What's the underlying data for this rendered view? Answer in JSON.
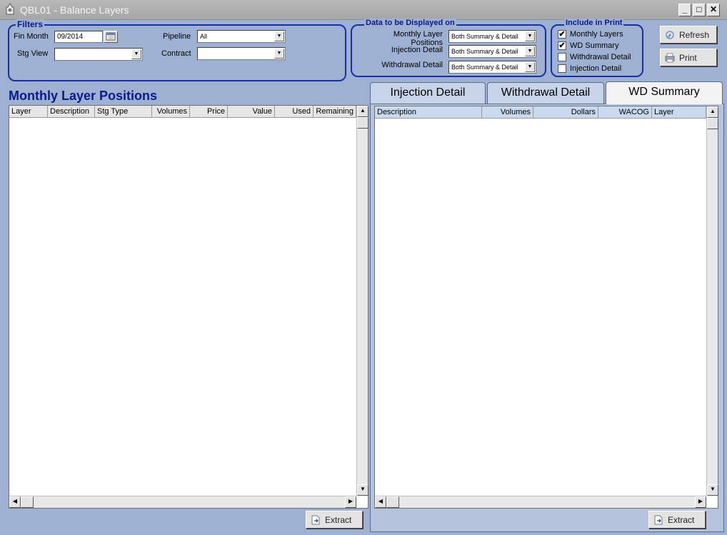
{
  "window": {
    "title": "QBL01 - Balance Layers",
    "minimize": "_",
    "maximize": "□",
    "close": "✕"
  },
  "filters": {
    "group_title": "Filters",
    "fin_month_label": "Fin Month",
    "fin_month_value": "09/2014",
    "stg_view_label": "Stg View",
    "stg_view_value": "",
    "pipeline_label": "Pipeline",
    "pipeline_value": "All",
    "contract_label": "Contract",
    "contract_value": ""
  },
  "display": {
    "group_title": "Data to be Displayed on",
    "rows": [
      {
        "label": "Monthly Layer Positions",
        "value": "Both Summary & Detail"
      },
      {
        "label": "Injection Detail",
        "value": "Both Summary & Detail"
      },
      {
        "label": "Withdrawal Detail",
        "value": "Both Summary & Detail"
      }
    ]
  },
  "print_opts": {
    "group_title": "Include in Print",
    "items": [
      {
        "label": "Monthly Layers",
        "checked": "✔"
      },
      {
        "label": "WD Summary",
        "checked": "✔"
      },
      {
        "label": "Withdrawal Detail",
        "checked": ""
      },
      {
        "label": "Injection Detail",
        "checked": ""
      }
    ]
  },
  "buttons": {
    "refresh": "Refresh",
    "print": "Print",
    "extract": "Extract"
  },
  "left_panel": {
    "heading": "Monthly Layer Positions",
    "columns": [
      "Layer",
      "Description",
      "Stg Type",
      "Volumes",
      "Price",
      "Value",
      "Used",
      "Remaining"
    ]
  },
  "tabs": [
    {
      "label": "Injection Detail"
    },
    {
      "label": "Withdrawal Detail"
    },
    {
      "label": "WD Summary"
    }
  ],
  "right_panel": {
    "columns": [
      "Description",
      "Volumes",
      "Dollars",
      "WACOG",
      "Layer"
    ]
  },
  "colors": {
    "background": "#9fb1d3",
    "accent": "#0a1a8a",
    "group_border": "#1a2fa0"
  },
  "icons": {
    "app": "app-icon",
    "calendar": "calendar-icon",
    "refresh": "refresh-icon",
    "print": "printer-icon",
    "extract": "document-export-icon"
  }
}
